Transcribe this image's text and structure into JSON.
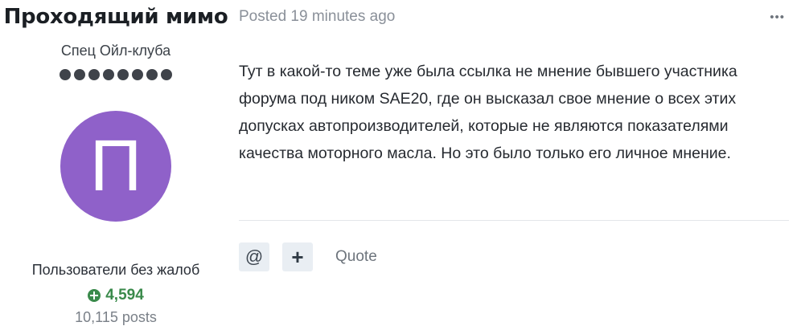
{
  "author": {
    "name": "Проходящий мимо",
    "rank_title": "Спец Ойл-клуба",
    "rank_pips": 8,
    "avatar_letter": "П",
    "avatar_color": "#8f61c9",
    "group": "Пользователи без жалоб",
    "reputation": "4,594",
    "reputation_color": "#3a8a4b",
    "post_count": "10,115 posts"
  },
  "post": {
    "meta": "Posted 19 minutes ago",
    "menu_icon": "ellipsis-icon",
    "menu_label": "•••",
    "body": "Тут в какой-то теме уже была ссылка не мнение бывшего участника форума под ником SAE20, где он высказал свое мнение о всех этих допусках автопроизводителей, которые не являются показателями качества моторного масла. Но это было только его личное мнение.",
    "actions": {
      "mention_label": "@",
      "plus_label": "+",
      "quote_label": "Quote"
    }
  }
}
